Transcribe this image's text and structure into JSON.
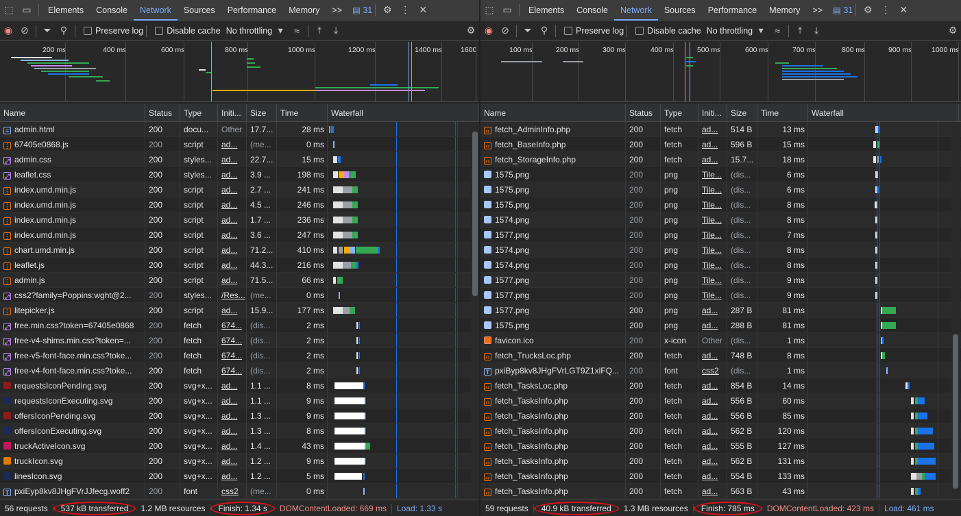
{
  "left": {
    "tabs": [
      "Elements",
      "Console",
      "Network",
      "Sources",
      "Performance",
      "Memory"
    ],
    "more": ">>",
    "badge": "31",
    "toolbar": {
      "preserve": "Preserve log",
      "cache": "Disable cache",
      "throttle": "No throttling"
    },
    "ticks": [
      "200 ms",
      "400 ms",
      "600 ms",
      "800 ms",
      "1000 ms",
      "1200 ms",
      "1400 ms",
      "1600"
    ],
    "headers": [
      "Name",
      "Status",
      "Type",
      "Initi...",
      "Size",
      "Time",
      "Waterfall"
    ],
    "rows": [
      {
        "icon": "doc",
        "name": "admin.html",
        "status": "200",
        "type": "docu...",
        "init": "Other",
        "size": "17.7...",
        "time": "28 ms",
        "dimStatus": false,
        "initUl": false,
        "dimInit": true,
        "dimSize": false
      },
      {
        "icon": "script",
        "name": "67405e0868.js",
        "status": "200",
        "type": "script",
        "init": "ad...",
        "size": "(me...",
        "time": "0 ms",
        "dimStatus": true,
        "initUl": true,
        "dimSize": true
      },
      {
        "icon": "css",
        "name": "admin.css",
        "status": "200",
        "type": "styles...",
        "init": "ad...",
        "size": "22.7...",
        "time": "15 ms",
        "initUl": true
      },
      {
        "icon": "css",
        "name": "leaflet.css",
        "status": "200",
        "type": "styles...",
        "init": "ad...",
        "size": "3.9 ...",
        "time": "198 ms",
        "initUl": true
      },
      {
        "icon": "script",
        "name": "index.umd.min.js",
        "status": "200",
        "type": "script",
        "init": "ad...",
        "size": "2.7 ...",
        "time": "241 ms",
        "initUl": true
      },
      {
        "icon": "script",
        "name": "index.umd.min.js",
        "status": "200",
        "type": "script",
        "init": "ad...",
        "size": "4.5 ...",
        "time": "246 ms",
        "initUl": true
      },
      {
        "icon": "script",
        "name": "index.umd.min.js",
        "status": "200",
        "type": "script",
        "init": "ad...",
        "size": "1.7 ...",
        "time": "236 ms",
        "initUl": true
      },
      {
        "icon": "script",
        "name": "index.umd.min.js",
        "status": "200",
        "type": "script",
        "init": "ad...",
        "size": "3.6 ...",
        "time": "247 ms",
        "initUl": true
      },
      {
        "icon": "script",
        "name": "chart.umd.min.js",
        "status": "200",
        "type": "script",
        "init": "ad...",
        "size": "71.2...",
        "time": "410 ms",
        "initUl": true
      },
      {
        "icon": "script",
        "name": "leaflet.js",
        "status": "200",
        "type": "script",
        "init": "ad...",
        "size": "44.3...",
        "time": "216 ms",
        "initUl": true
      },
      {
        "icon": "script",
        "name": "admin.js",
        "status": "200",
        "type": "script",
        "init": "ad...",
        "size": "71.5...",
        "time": "66 ms",
        "initUl": true
      },
      {
        "icon": "css",
        "name": "css2?family=Poppins:wght@2...",
        "status": "200",
        "type": "styles...",
        "init": "/Res...",
        "size": "(me...",
        "time": "0 ms",
        "dimStatus": true,
        "initUl": true,
        "dimSize": true
      },
      {
        "icon": "script",
        "name": "litepicker.js",
        "status": "200",
        "type": "script",
        "init": "ad...",
        "size": "15.9...",
        "time": "177 ms",
        "initUl": true
      },
      {
        "icon": "css",
        "name": "free.min.css?token=67405e0868",
        "status": "200",
        "type": "fetch",
        "init": "674...",
        "size": "(dis...",
        "time": "2 ms",
        "dimStatus": true,
        "initUl": true,
        "dimSize": true
      },
      {
        "icon": "css",
        "name": "free-v4-shims.min.css?token=...",
        "status": "200",
        "type": "fetch",
        "init": "674...",
        "size": "(dis...",
        "time": "2 ms",
        "dimStatus": true,
        "initUl": true,
        "dimSize": true
      },
      {
        "icon": "css",
        "name": "free-v5-font-face.min.css?toke...",
        "status": "200",
        "type": "fetch",
        "init": "674...",
        "size": "(dis...",
        "time": "2 ms",
        "dimStatus": true,
        "initUl": true,
        "dimSize": true
      },
      {
        "icon": "css",
        "name": "free-v4-font-face.min.css?toke...",
        "status": "200",
        "type": "fetch",
        "init": "674...",
        "size": "(dis...",
        "time": "2 ms",
        "initUl": true,
        "dimSize": true
      },
      {
        "icon": "svgred",
        "name": "requestsIconPending.svg",
        "status": "200",
        "type": "svg+x...",
        "init": "ad...",
        "size": "1.1 ...",
        "time": "8 ms",
        "initUl": true
      },
      {
        "icon": "svgblue",
        "name": "requestsIconExecuting.svg",
        "status": "200",
        "type": "svg+x...",
        "init": "ad...",
        "size": "1.1 ...",
        "time": "9 ms",
        "initUl": true
      },
      {
        "icon": "svgred",
        "name": "offersIconPending.svg",
        "status": "200",
        "type": "svg+x...",
        "init": "ad...",
        "size": "1.3 ...",
        "time": "9 ms",
        "initUl": true
      },
      {
        "icon": "svgblue",
        "name": "offersIconExecuting.svg",
        "status": "200",
        "type": "svg+x...",
        "init": "ad...",
        "size": "1.3 ...",
        "time": "8 ms",
        "initUl": true
      },
      {
        "icon": "svgpink",
        "name": "truckActiveIcon.svg",
        "status": "200",
        "type": "svg+x...",
        "init": "ad...",
        "size": "1.4 ...",
        "time": "43 ms",
        "initUl": true
      },
      {
        "icon": "svgorange",
        "name": "truckIcon.svg",
        "status": "200",
        "type": "svg+x...",
        "init": "ad...",
        "size": "1.2 ...",
        "time": "9 ms",
        "initUl": true
      },
      {
        "icon": "svgblue",
        "name": "linesIcon.svg",
        "status": "200",
        "type": "svg+x...",
        "init": "ad...",
        "size": "1.2 ...",
        "time": "5 ms",
        "initUl": true
      },
      {
        "icon": "font",
        "name": "pxiEyp8kv8JHgFVrJJfecg.woff2",
        "status": "200",
        "type": "font",
        "init": "css2",
        "size": "(me...",
        "time": "0 ms",
        "dimStatus": true,
        "initUl": true,
        "dimSize": true
      }
    ],
    "status": {
      "requests": "56 requests",
      "transferred": "537 kB transferred",
      "resources": "1.2 MB resources",
      "finish": "Finish: 1.34 s",
      "dcl": "DOMContentLoaded: 669 ms",
      "load": "Load: 1.33 s"
    }
  },
  "right": {
    "tabs": [
      "Elements",
      "Console",
      "Network",
      "Sources",
      "Performance",
      "Memory"
    ],
    "more": ">>",
    "badge": "31",
    "toolbar": {
      "preserve": "Preserve log",
      "cache": "Disable cache",
      "throttle": "No throttling"
    },
    "ticks": [
      "100 ms",
      "200 ms",
      "300 ms",
      "400 ms",
      "500 ms",
      "600 ms",
      "700 ms",
      "800 ms",
      "900 ms",
      "1000 ms"
    ],
    "headers": [
      "Name",
      "Status",
      "Type",
      "Initi...",
      "Size",
      "Time",
      "Waterfall"
    ],
    "rows": [
      {
        "icon": "php",
        "name": "fetch_AdminInfo.php",
        "status": "200",
        "type": "fetch",
        "init": "ad...",
        "size": "514 B",
        "time": "13 ms",
        "initUl": true
      },
      {
        "icon": "php",
        "name": "fetch_BaseInfo.php",
        "status": "200",
        "type": "fetch",
        "init": "ad...",
        "size": "596 B",
        "time": "15 ms",
        "initUl": true
      },
      {
        "icon": "php",
        "name": "fetch_StorageInfo.php",
        "status": "200",
        "type": "fetch",
        "init": "ad...",
        "size": "15.7...",
        "time": "18 ms",
        "initUl": true
      },
      {
        "icon": "png",
        "name": "1575.png",
        "status": "200",
        "type": "png",
        "init": "Tile...",
        "size": "(dis...",
        "time": "6 ms",
        "dimStatus": true,
        "initUl": true,
        "dimSize": true
      },
      {
        "icon": "png",
        "name": "1575.png",
        "status": "200",
        "type": "png",
        "init": "Tile...",
        "size": "(dis...",
        "time": "6 ms",
        "dimStatus": true,
        "initUl": true,
        "dimSize": true
      },
      {
        "icon": "png",
        "name": "1575.png",
        "status": "200",
        "type": "png",
        "init": "Tile...",
        "size": "(dis...",
        "time": "8 ms",
        "dimStatus": true,
        "initUl": true,
        "dimSize": true
      },
      {
        "icon": "png",
        "name": "1574.png",
        "status": "200",
        "type": "png",
        "init": "Tile...",
        "size": "(dis...",
        "time": "8 ms",
        "dimStatus": true,
        "initUl": true,
        "dimSize": true
      },
      {
        "icon": "png",
        "name": "1577.png",
        "status": "200",
        "type": "png",
        "init": "Tile...",
        "size": "(dis...",
        "time": "7 ms",
        "dimStatus": true,
        "initUl": true,
        "dimSize": true
      },
      {
        "icon": "png",
        "name": "1574.png",
        "status": "200",
        "type": "png",
        "init": "Tile...",
        "size": "(dis...",
        "time": "8 ms",
        "dimStatus": true,
        "initUl": true,
        "dimSize": true
      },
      {
        "icon": "png",
        "name": "1574.png",
        "status": "200",
        "type": "png",
        "init": "Tile...",
        "size": "(dis...",
        "time": "8 ms",
        "dimStatus": true,
        "initUl": true,
        "dimSize": true
      },
      {
        "icon": "png",
        "name": "1577.png",
        "status": "200",
        "type": "png",
        "init": "Tile...",
        "size": "(dis...",
        "time": "9 ms",
        "dimStatus": true,
        "initUl": true,
        "dimSize": true
      },
      {
        "icon": "png",
        "name": "1577.png",
        "status": "200",
        "type": "png",
        "init": "Tile...",
        "size": "(dis...",
        "time": "9 ms",
        "dimStatus": true,
        "initUl": true,
        "dimSize": true
      },
      {
        "icon": "png",
        "name": "1577.png",
        "status": "200",
        "type": "png",
        "init": "ad...",
        "size": "287 B",
        "time": "81 ms",
        "initUl": true
      },
      {
        "icon": "png",
        "name": "1575.png",
        "status": "200",
        "type": "png",
        "init": "ad...",
        "size": "288 B",
        "time": "81 ms",
        "initUl": true
      },
      {
        "icon": "ico",
        "name": "favicon.ico",
        "status": "200",
        "type": "x-icon",
        "init": "Other",
        "size": "(dis...",
        "time": "1 ms",
        "dimStatus": true,
        "dimInit": true,
        "dimSize": true
      },
      {
        "icon": "php",
        "name": "fetch_TrucksLoc.php",
        "status": "200",
        "type": "fetch",
        "init": "ad...",
        "size": "748 B",
        "time": "8 ms",
        "initUl": true
      },
      {
        "icon": "font",
        "name": "pxiByp8kv8JHgFVrLGT9Z1xlFQ...",
        "status": "200",
        "type": "font",
        "init": "css2",
        "size": "(dis...",
        "time": "1 ms",
        "dimStatus": true,
        "initUl": true,
        "dimSize": true
      },
      {
        "icon": "php",
        "name": "fetch_TasksLoc.php",
        "status": "200",
        "type": "fetch",
        "init": "ad...",
        "size": "854 B",
        "time": "14 ms",
        "initUl": true
      },
      {
        "icon": "php",
        "name": "fetch_TasksInfo.php",
        "status": "200",
        "type": "fetch",
        "init": "ad...",
        "size": "556 B",
        "time": "60 ms",
        "initUl": true
      },
      {
        "icon": "php",
        "name": "fetch_TasksInfo.php",
        "status": "200",
        "type": "fetch",
        "init": "ad...",
        "size": "556 B",
        "time": "85 ms",
        "initUl": true
      },
      {
        "icon": "php",
        "name": "fetch_TasksInfo.php",
        "status": "200",
        "type": "fetch",
        "init": "ad...",
        "size": "562 B",
        "time": "120 ms",
        "initUl": true
      },
      {
        "icon": "php",
        "name": "fetch_TasksInfo.php",
        "status": "200",
        "type": "fetch",
        "init": "ad...",
        "size": "555 B",
        "time": "127 ms",
        "initUl": true
      },
      {
        "icon": "php",
        "name": "fetch_TasksInfo.php",
        "status": "200",
        "type": "fetch",
        "init": "ad...",
        "size": "562 B",
        "time": "131 ms",
        "initUl": true
      },
      {
        "icon": "php",
        "name": "fetch_TasksInfo.php",
        "status": "200",
        "type": "fetch",
        "init": "ad...",
        "size": "554 B",
        "time": "133 ms",
        "initUl": true
      },
      {
        "icon": "php",
        "name": "fetch_TasksInfo.php",
        "status": "200",
        "type": "fetch",
        "init": "ad...",
        "size": "563 B",
        "time": "43 ms",
        "initUl": true
      }
    ],
    "status": {
      "requests": "59 requests",
      "transferred": "40.9 kB transferred",
      "resources": "1.3 MB resources",
      "finish": "Finish: 785 ms",
      "dcl": "DOMContentLoaded: 423 ms",
      "load": "Load: 461 ms"
    }
  },
  "colors": {
    "accent": "#7cacf8",
    "dcl": "#f28b82",
    "annotation": "#e0101a"
  }
}
